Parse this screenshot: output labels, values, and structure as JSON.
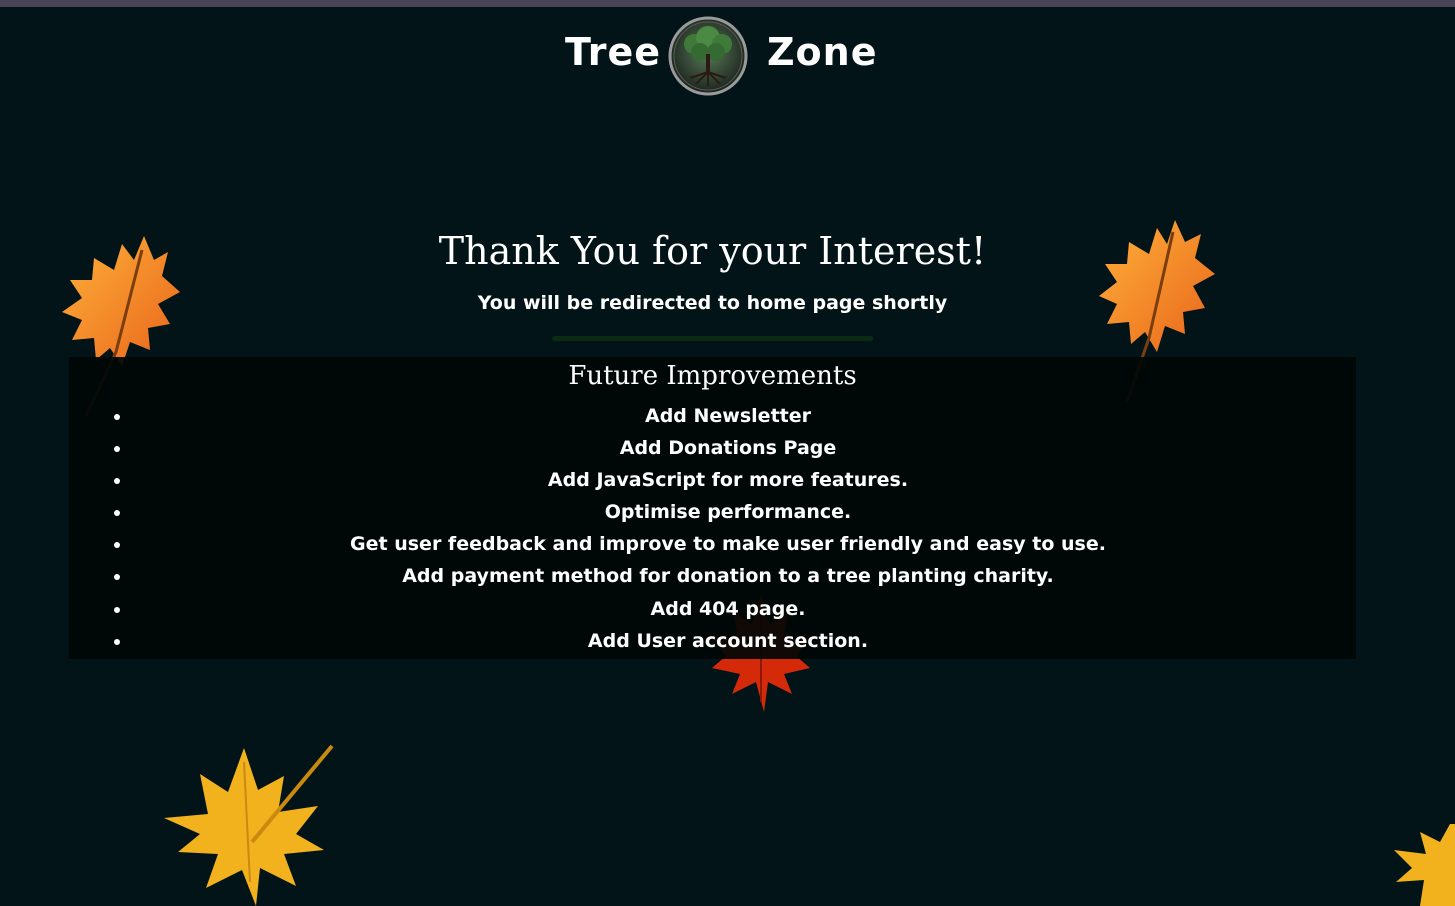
{
  "header": {
    "brand_left": "Tree",
    "brand_right": "Zone",
    "logo_icon": "tree-of-life-icon"
  },
  "hero": {
    "title": "Thank You for your Interest!",
    "subtitle": "You will be redirected to home page shortly",
    "progress_percent": 0
  },
  "improvements": {
    "title": "Future Improvements",
    "items": [
      "Add Newsletter",
      "Add Donations Page",
      "Add JavaScript for more features.",
      "Optimise performance.",
      "Get user feedback and improve to make user friendly and easy to use.",
      "Add payment method for donation to a tree planting charity.",
      "Add 404 page.",
      "Add User account section."
    ]
  },
  "decor": {
    "icons": [
      "oak-leaf-icon",
      "maple-leaf-icon"
    ],
    "colors": {
      "background": "#021417",
      "orange_leaf": "#f28c1e",
      "yellow_leaf": "#f2b21e",
      "red_leaf": "#d42a0a",
      "progress": "#0a4a1a"
    }
  }
}
